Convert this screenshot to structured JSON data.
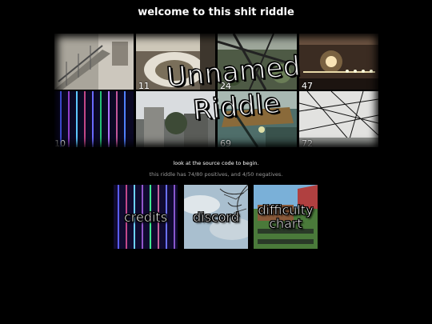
{
  "site": {
    "title": "welcome to this shit riddle"
  },
  "banner": {
    "line1": "Unnamed",
    "line2": "Riddle",
    "tiles": [
      {
        "number": "",
        "icon": "stairwell-photo"
      },
      {
        "number": "11",
        "icon": "toilet-photo"
      },
      {
        "number": "24",
        "icon": "greenhouse-photo"
      },
      {
        "number": "47",
        "icon": "restaurant-lights-photo"
      },
      {
        "number": "10",
        "icon": "led-lights-photo"
      },
      {
        "number": "",
        "icon": "buildings-photo"
      },
      {
        "number": "69",
        "icon": "balcony-photo"
      },
      {
        "number": "72",
        "icon": "power-lines-photo"
      }
    ]
  },
  "intro": {
    "instruction": "look at the source code to begin.",
    "stats": "this riddle has 74/80 positives, and 4/50 negatives."
  },
  "nav": {
    "credits": "credits",
    "discord": "discord",
    "difficulty_line1": "difficulty",
    "difficulty_line2": "chart"
  },
  "colors": {
    "background": "#000000",
    "text": "#ffffff",
    "muted_text": "#9a9a9a"
  }
}
